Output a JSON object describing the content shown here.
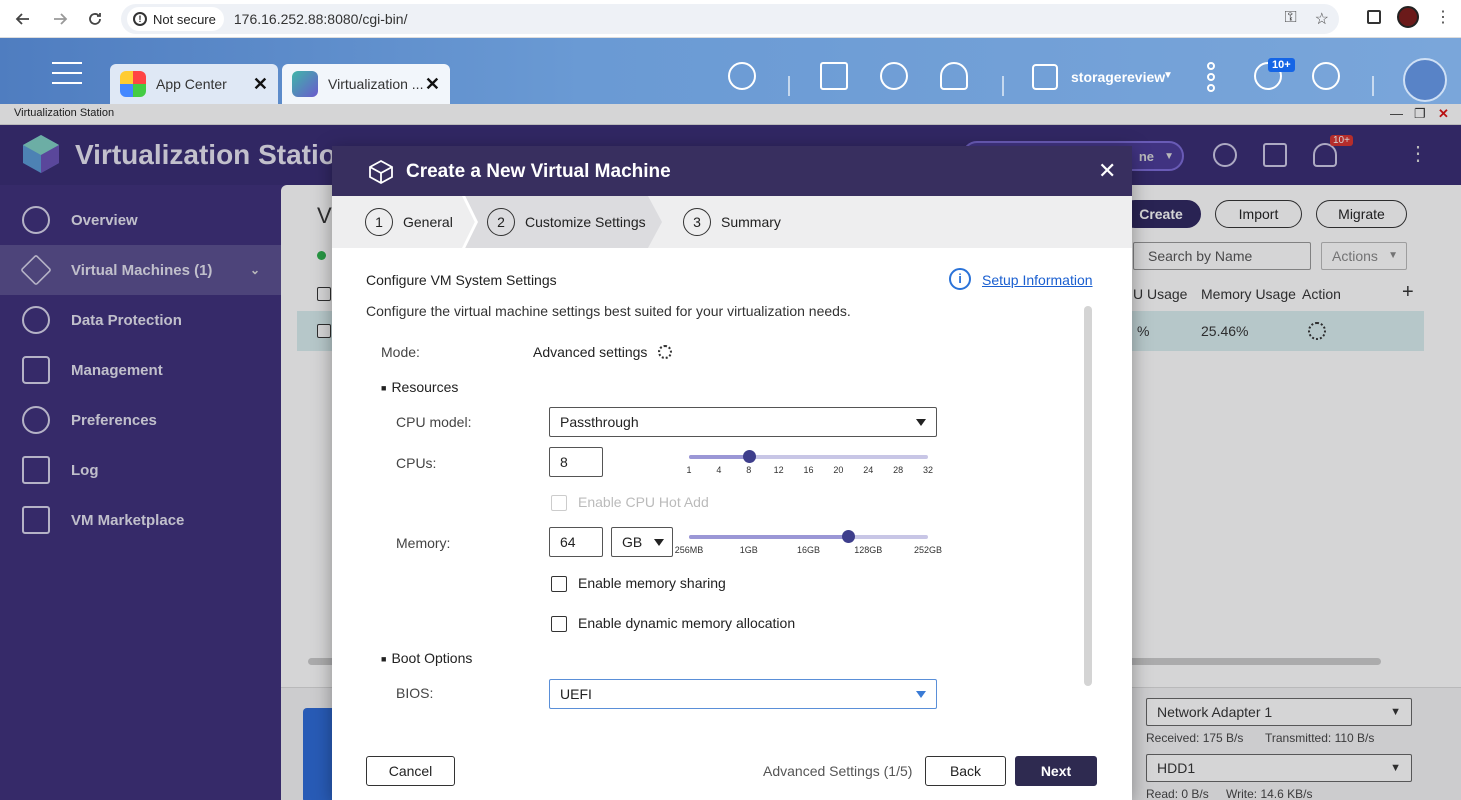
{
  "browser": {
    "security_label": "Not secure",
    "url": "176.16.252.88:8080/cgi-bin/"
  },
  "qts": {
    "tabs": [
      {
        "label": "App Center"
      },
      {
        "label": "Virtualization ..."
      }
    ],
    "username": "storagereview",
    "notification_badge": "10+"
  },
  "window": {
    "title": "Virtualization Station"
  },
  "app": {
    "name": "Virtualization Station",
    "header_pill_suffix": "ne",
    "notification_badge": "10+",
    "sidebar": [
      {
        "label": "Overview"
      },
      {
        "label": "Virtual Machines (1)"
      },
      {
        "label": "Data Protection"
      },
      {
        "label": "Management"
      },
      {
        "label": "Preferences"
      },
      {
        "label": "Log"
      },
      {
        "label": "VM Marketplace"
      }
    ],
    "content": {
      "heading_fragment": "V",
      "buttons": {
        "create": "Create",
        "import": "Import",
        "migrate": "Migrate"
      },
      "search_placeholder": "Search by Name",
      "actions_label": "Actions",
      "columns": {
        "cpu_usage": "U Usage",
        "memory_usage": "Memory Usage",
        "action": "Action",
        "add": "+"
      },
      "row": {
        "cpu_usage": "%",
        "memory_usage": "25.46%"
      },
      "network_adapter": "Network Adapter 1",
      "received": "Received: 175 B/s",
      "transmitted": "Transmitted: 110 B/s",
      "disk": "HDD1",
      "read": "Read: 0 B/s",
      "write": "Write: 14.6 KB/s"
    }
  },
  "modal": {
    "title": "Create a New Virtual Machine",
    "close_label": "✕",
    "steps": [
      {
        "num": "1",
        "label": "General"
      },
      {
        "num": "2",
        "label": "Customize Settings"
      },
      {
        "num": "3",
        "label": "Summary"
      }
    ],
    "active_step": 2,
    "heading": "Configure VM System Settings",
    "setup_info_link": "Setup Information",
    "description": "Configure the virtual machine settings best suited for your virtualization needs.",
    "mode_label": "Mode:",
    "mode_value": "Advanced settings",
    "resources_label": "Resources",
    "cpu_model_label": "CPU model:",
    "cpu_model_value": "Passthrough",
    "cpus_label": "CPUs:",
    "cpus_value": "8",
    "cpu_ticks": [
      "1",
      "4",
      "8",
      "12",
      "16",
      "20",
      "24",
      "28",
      "32"
    ],
    "cpu_slider_value": 8,
    "cpu_hot_add_label": "Enable CPU Hot Add",
    "memory_label": "Memory:",
    "memory_value": "64",
    "memory_unit": "GB",
    "memory_ticks": [
      "256MB",
      "1GB",
      "16GB",
      "128GB",
      "252GB"
    ],
    "memory_slider_value": "64GB",
    "memory_sharing_label": "Enable memory sharing",
    "dynamic_memory_label": "Enable dynamic memory allocation",
    "boot_options_label": "Boot Options",
    "bios_label": "BIOS:",
    "bios_value": "UEFI",
    "cancel_label": "Cancel",
    "footer_info": "Advanced Settings (1/5)",
    "back_label": "Back",
    "next_label": "Next"
  }
}
